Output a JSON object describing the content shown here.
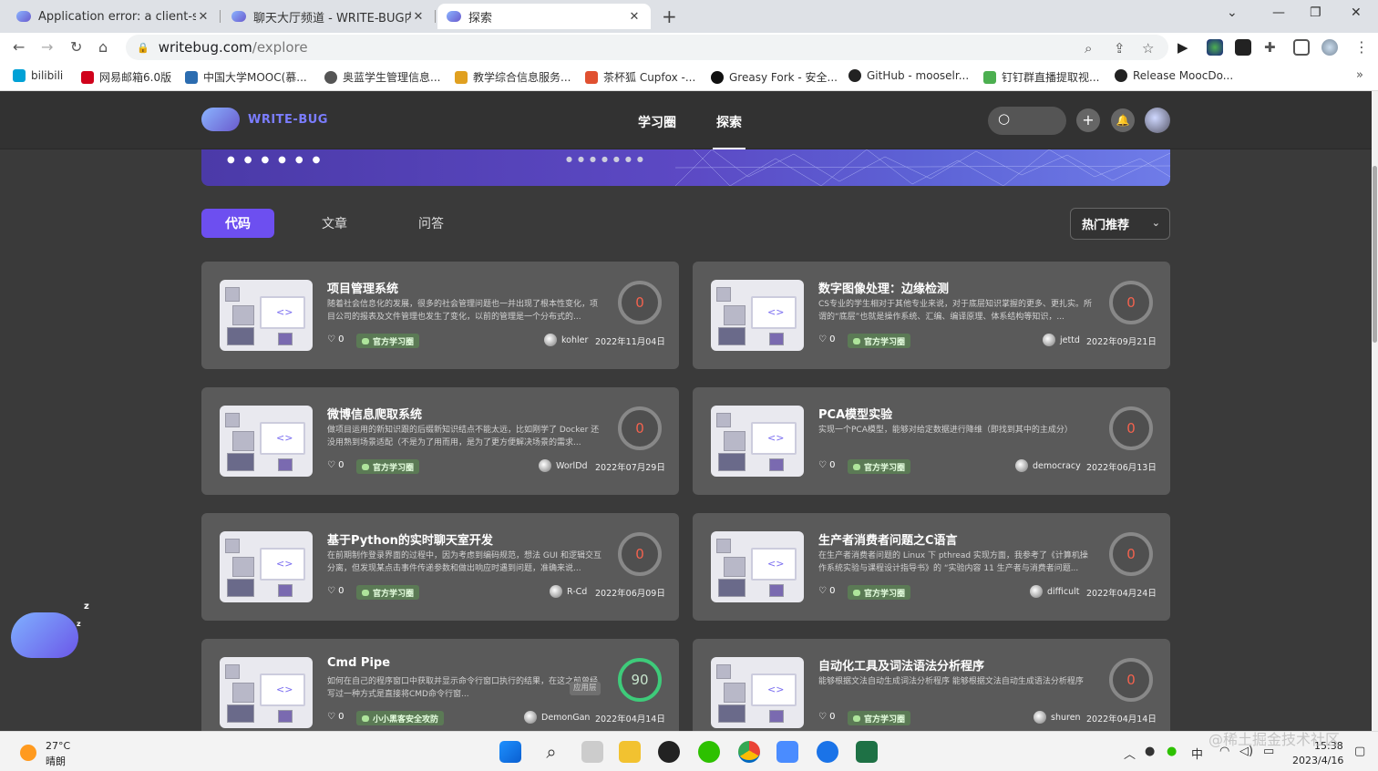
{
  "browser": {
    "tabs": [
      {
        "title": "Application error: a client-side"
      },
      {
        "title": "聊天大厅频道 - WRITE-BUG内容"
      },
      {
        "title": "探索"
      }
    ],
    "url_host": "writebug.com",
    "url_path": "/explore",
    "bookmarks": [
      {
        "label": "bilibili",
        "color": "#00a1d6"
      },
      {
        "label": "网易邮箱6.0版",
        "color": "#d0021b"
      },
      {
        "label": "中国大学MOOC(慕...",
        "color": "#2b6cb0"
      },
      {
        "label": "奥蓝学生管理信息...",
        "color": "#555555"
      },
      {
        "label": "教学综合信息服务...",
        "color": "#e0a020"
      },
      {
        "label": "茶杯狐 Cupfox -...",
        "color": "#e05030"
      },
      {
        "label": "Greasy Fork - 安全...",
        "color": "#111111"
      },
      {
        "label": "GitHub - mooselr...",
        "color": "#222222"
      },
      {
        "label": "钉钉群直播提取视...",
        "color": "#4caf50"
      },
      {
        "label": "Release MoocDo...",
        "color": "#222222"
      }
    ],
    "bookmarks_more": "»"
  },
  "site": {
    "logo_text": "WRITE-BUG",
    "nav": [
      "学习圈",
      "探索"
    ],
    "tabs": [
      "代码",
      "文章",
      "问答"
    ],
    "sort_label": "热门推荐",
    "accent": "#6d4ff0"
  },
  "cards": [
    {
      "title": "项目管理系统",
      "desc": "随着社会信息化的发展，很多的社会管理问题也一并出现了根本性变化，项目公司的报表及文件管理也发生了变化，以前的管理是一个分布式的...",
      "likes": "0",
      "tag": "官方学习圈",
      "author": "kohler",
      "date": "2022年11月04日",
      "score": "0"
    },
    {
      "title": "数字图像处理：边缘检测",
      "desc": "CS专业的学生相对于其他专业来说，对于底层知识掌握的更多、更扎实。所谓的“底层”也就是操作系统、汇编、编译原理、体系结构等知识，...",
      "likes": "0",
      "tag": "官方学习圈",
      "author": "jettd",
      "date": "2022年09月21日",
      "score": "0"
    },
    {
      "title": "微博信息爬取系统",
      "desc": "做项目运用的新知识跟的后缀新知识结点不能太远，比如刚学了 Docker 还没用熟到场景适配（不是为了用而用，是为了更方便解决场景的需求...",
      "likes": "0",
      "tag": "官方学习圈",
      "author": "WorlDd",
      "date": "2022年07月29日",
      "score": "0"
    },
    {
      "title": "PCA模型实验",
      "desc": "实现一个PCA模型，能够对给定数据进行降维（即找到其中的主成分）",
      "likes": "0",
      "tag": "官方学习圈",
      "author": "democracy",
      "date": "2022年06月13日",
      "score": "0"
    },
    {
      "title": "基于Python的实时聊天室开发",
      "desc": "在前期制作登录界面的过程中，因为考虑到编码规范，想法 GUI 和逻辑交互分离，但发现某点击事件传递参数和做出响应时遇到问题，准确来说...",
      "likes": "0",
      "tag": "官方学习圈",
      "author": "R-Cd",
      "date": "2022年06月09日",
      "score": "0"
    },
    {
      "title": "生产者消费者问题之C语言",
      "desc": "在生产者消费者问题的 Linux 下 pthread 实现方面，我参考了《计算机操作系统实验与课程设计指导书》的 “实验内容 11 生产者与消费者问题...",
      "likes": "0",
      "tag": "官方学习圈",
      "author": "difficult",
      "date": "2022年04月24日",
      "score": "0"
    },
    {
      "title": "Cmd Pipe",
      "desc": "如何在自己的程序窗口中获取并显示命令行窗口执行的结果，在这之前曾经写过一种方式是直接将CMD命令行窗...",
      "likes": "0",
      "tag": "小小黑客安全攻防",
      "author": "DemonGan",
      "date": "2022年04月14日",
      "score": "90",
      "badge": "应用层"
    },
    {
      "title": "自动化工具及词法语法分析程序",
      "desc": "能够根据文法自动生成词法分析程序 能够根据文法自动生成语法分析程序",
      "likes": "0",
      "tag": "官方学习圈",
      "author": "shuren",
      "date": "2022年04月14日",
      "score": "0"
    }
  ],
  "taskbar": {
    "temp": "27°C",
    "weather": "晴朗",
    "ime": "中",
    "time": "15:38",
    "date": "2023/4/16"
  },
  "watermark": "@稀土掘金技术社区"
}
